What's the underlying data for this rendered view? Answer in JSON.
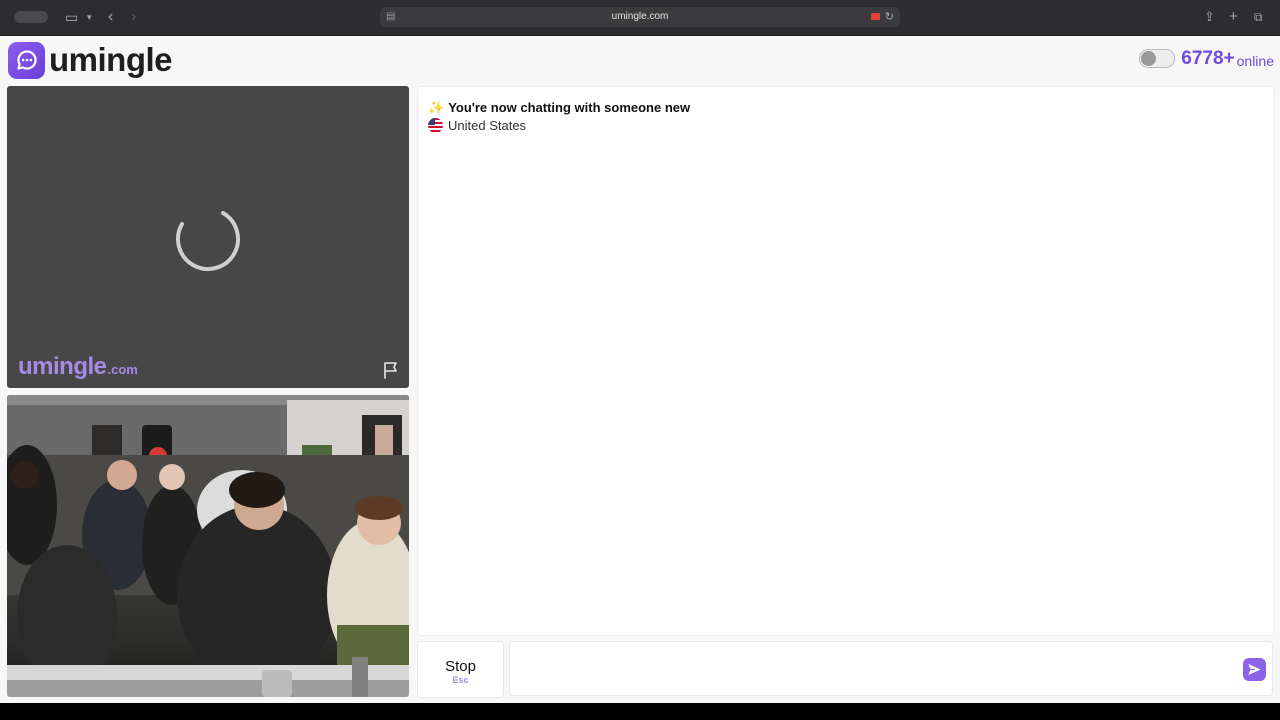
{
  "browser": {
    "url": "umingle.com"
  },
  "header": {
    "logo_text": "umingle",
    "online_count": "6778+",
    "online_label": "online"
  },
  "video": {
    "watermark_main": "umingle",
    "watermark_suffix": ".com"
  },
  "chat": {
    "status_emoji": "✨",
    "status_text": "You're now chatting with someone new",
    "country": "United States"
  },
  "controls": {
    "stop_label": "Stop",
    "stop_shortcut": "Esc",
    "message_placeholder": ""
  },
  "colors": {
    "brand": "#7b52e8",
    "brand_light": "#a58ae6"
  }
}
